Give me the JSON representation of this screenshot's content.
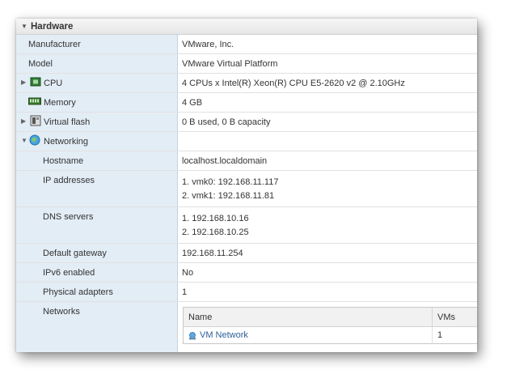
{
  "header": {
    "title": "Hardware"
  },
  "rows": {
    "manufacturer": {
      "label": "Manufacturer",
      "value": "VMware, Inc."
    },
    "model": {
      "label": "Model",
      "value": "VMware Virtual Platform"
    },
    "cpu": {
      "label": "CPU",
      "value": "4 CPUs x Intel(R) Xeon(R) CPU E5-2620 v2 @ 2.10GHz",
      "icon": "cpu-icon"
    },
    "memory": {
      "label": "Memory",
      "value": "4 GB",
      "icon": "memory-icon"
    },
    "virtual_flash": {
      "label": "Virtual flash",
      "value": "0 B used, 0 B capacity",
      "icon": "flash-icon"
    },
    "networking": {
      "label": "Networking",
      "icon": "network-globe-icon"
    },
    "hostname": {
      "label": "Hostname",
      "value": "localhost.localdomain"
    },
    "ip_addresses": {
      "label": "IP addresses",
      "values": [
        "1. vmk0: 192.168.11.117",
        "2. vmk1: 192.168.11.81"
      ]
    },
    "dns_servers": {
      "label": "DNS servers",
      "values": [
        "1. 192.168.10.16",
        "2. 192.168.10.25"
      ]
    },
    "default_gateway": {
      "label": "Default gateway",
      "value": "192.168.11.254"
    },
    "ipv6_enabled": {
      "label": "IPv6 enabled",
      "value": "No"
    },
    "physical_adapters": {
      "label": "Physical adapters",
      "value": "1"
    },
    "networks": {
      "label": "Networks",
      "table": {
        "columns": [
          "Name",
          "VMs"
        ],
        "rows": [
          {
            "name": "VM Network",
            "vms": "1",
            "icon": "port-group-icon"
          }
        ]
      }
    }
  },
  "colors": {
    "label_column_bg": "#e3edf6",
    "link": "#2f5f9a",
    "header_bg": "#ececec"
  }
}
